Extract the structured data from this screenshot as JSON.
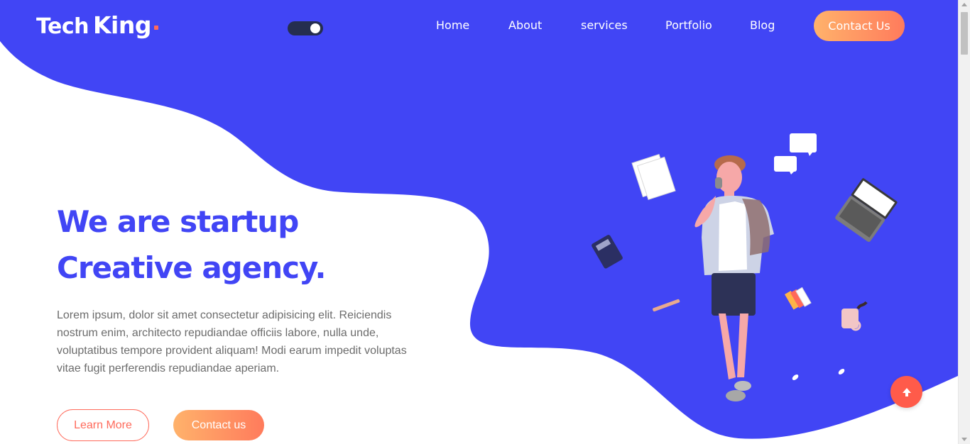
{
  "brand": {
    "name_part1": "Tech",
    "name_part2": "King",
    "accent_color": "#ff6a5b",
    "primary_color": "#4145f5"
  },
  "theme_toggle": {
    "state": "on"
  },
  "nav": {
    "items": [
      {
        "label": "Home"
      },
      {
        "label": "About"
      },
      {
        "label": "services"
      },
      {
        "label": "Portfolio"
      },
      {
        "label": "Blog"
      }
    ],
    "cta_label": "Contact Us"
  },
  "hero": {
    "title_line1": "We are startup",
    "title_line2": "Creative agency.",
    "description": "Lorem ipsum, dolor sit amet consectetur adipisicing elit. Reiciendis nostrum enim, architecto repudiandae officiis labore, nulla unde, voluptatibus tempore provident aliquam! Modi earum impedit voluptas vitae fugit perferendis repudiandae aperiam.",
    "learn_more_label": "Learn More",
    "contact_label": "Contact us"
  },
  "icons": {
    "scroll_top": "arrow-up-icon",
    "illustration": "person-on-phone-illustration"
  }
}
